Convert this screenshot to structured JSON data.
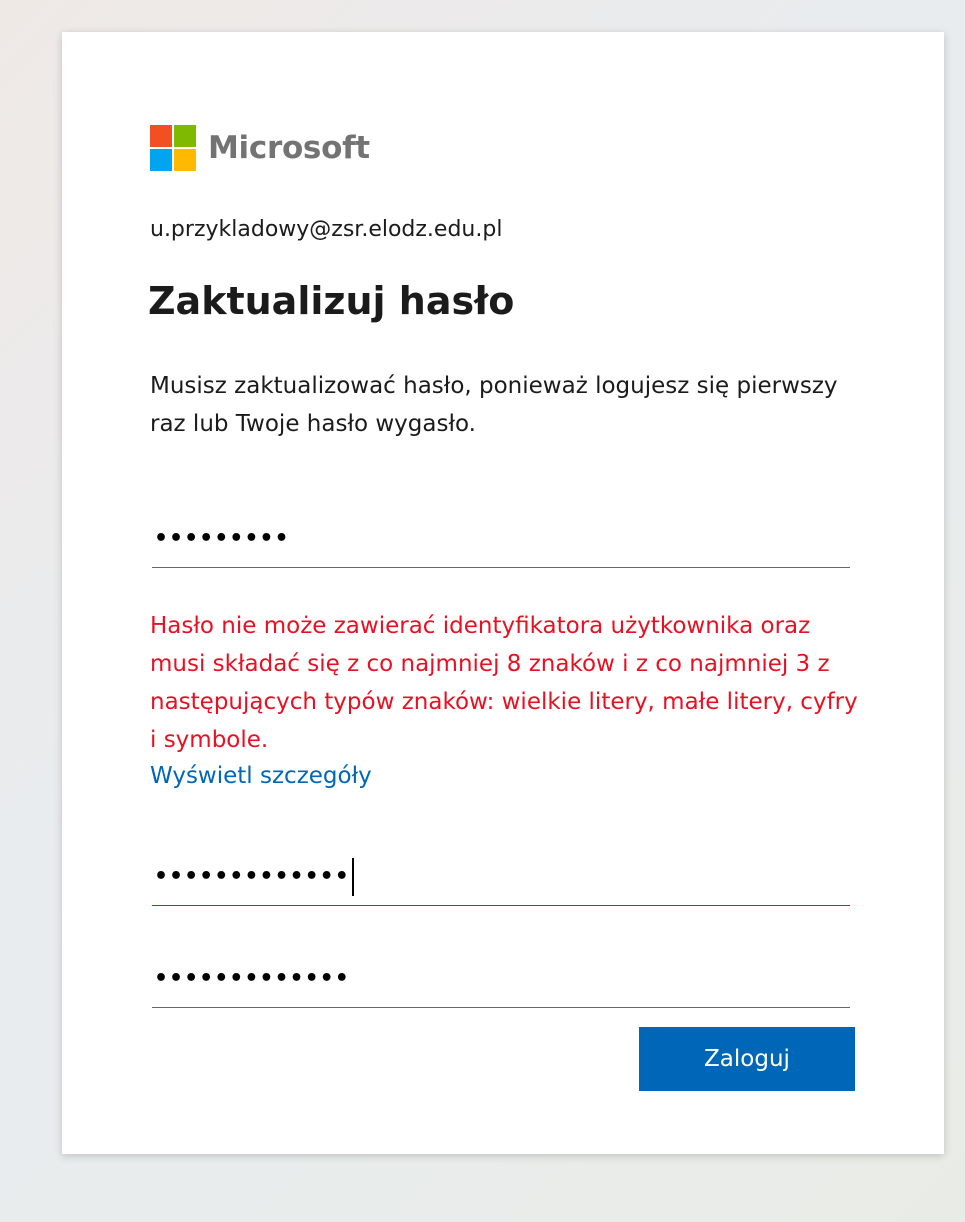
{
  "brand": {
    "name": "Microsoft",
    "logo_colors": [
      "#f25022",
      "#7fba00",
      "#00a4ef",
      "#ffb900"
    ]
  },
  "account": {
    "email": "u.przykladowy@zsr.elodz.edu.pl"
  },
  "page": {
    "title": "Zaktualizuj hasło",
    "description": "Musisz zaktualizować hasło, ponieważ logujesz się pierwszy raz lub Twoje hasło wygasło."
  },
  "fields": {
    "current_password": {
      "value": "•••••••••"
    },
    "new_password": {
      "value": "•••••••••••••"
    },
    "confirm_password": {
      "value": "•••••••••••••"
    }
  },
  "error": {
    "message": "Hasło nie może zawierać identyfikatora użytkownika oraz musi składać się z co najmniej 8 znaków i z co najmniej 3 z następujących typów znaków: wielkie litery, małe litery, cyfry i symbole.",
    "details_link": "Wyświetl szczegóły",
    "color": "#e81123"
  },
  "actions": {
    "submit_label": "Zaloguj",
    "accent_color": "#0067b8"
  }
}
